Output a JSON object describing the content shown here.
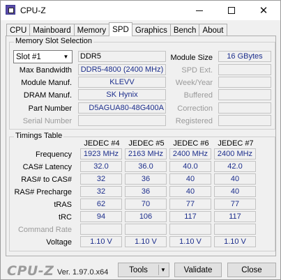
{
  "window": {
    "title": "CPU-Z"
  },
  "tabs": [
    "CPU",
    "Mainboard",
    "Memory",
    "SPD",
    "Graphics",
    "Bench",
    "About"
  ],
  "active_tab": "SPD",
  "slot_group": {
    "title": "Memory Slot Selection",
    "slot_selected": "Slot #1",
    "memory_type": "DDR5",
    "labels": {
      "module_size": "Module Size",
      "max_bandwidth": "Max Bandwidth",
      "module_manuf": "Module Manuf.",
      "dram_manuf": "DRAM Manuf.",
      "part_number": "Part Number",
      "serial_number": "Serial Number",
      "spd_ext": "SPD Ext.",
      "week_year": "Week/Year",
      "buffered": "Buffered",
      "correction": "Correction",
      "registered": "Registered"
    },
    "values": {
      "module_size": "16 GBytes",
      "max_bandwidth": "DDR5-4800 (2400 MHz)",
      "module_manuf": "KLEVV",
      "dram_manuf": "SK Hynix",
      "part_number": "D5AGUA80-48G400A"
    }
  },
  "timings": {
    "title": "Timings Table",
    "columns": [
      "JEDEC #4",
      "JEDEC #5",
      "JEDEC #6",
      "JEDEC #7"
    ],
    "rows": [
      {
        "label": "Frequency",
        "dim": false,
        "values": [
          "1923 MHz",
          "2163 MHz",
          "2400 MHz",
          "2400 MHz"
        ]
      },
      {
        "label": "CAS# Latency",
        "dim": false,
        "values": [
          "32.0",
          "36.0",
          "40.0",
          "42.0"
        ]
      },
      {
        "label": "RAS# to CAS#",
        "dim": false,
        "values": [
          "32",
          "36",
          "40",
          "40"
        ]
      },
      {
        "label": "RAS# Precharge",
        "dim": false,
        "values": [
          "32",
          "36",
          "40",
          "40"
        ]
      },
      {
        "label": "tRAS",
        "dim": false,
        "values": [
          "62",
          "70",
          "77",
          "77"
        ]
      },
      {
        "label": "tRC",
        "dim": false,
        "values": [
          "94",
          "106",
          "117",
          "117"
        ]
      },
      {
        "label": "Command Rate",
        "dim": true,
        "values": [
          "",
          "",
          "",
          ""
        ]
      },
      {
        "label": "Voltage",
        "dim": false,
        "values": [
          "1.10 V",
          "1.10 V",
          "1.10 V",
          "1.10 V"
        ]
      }
    ]
  },
  "footer": {
    "brand": "CPU-Z",
    "version": "Ver. 1.97.0.x64",
    "tools_label": "Tools",
    "validate_label": "Validate",
    "close_label": "Close"
  }
}
